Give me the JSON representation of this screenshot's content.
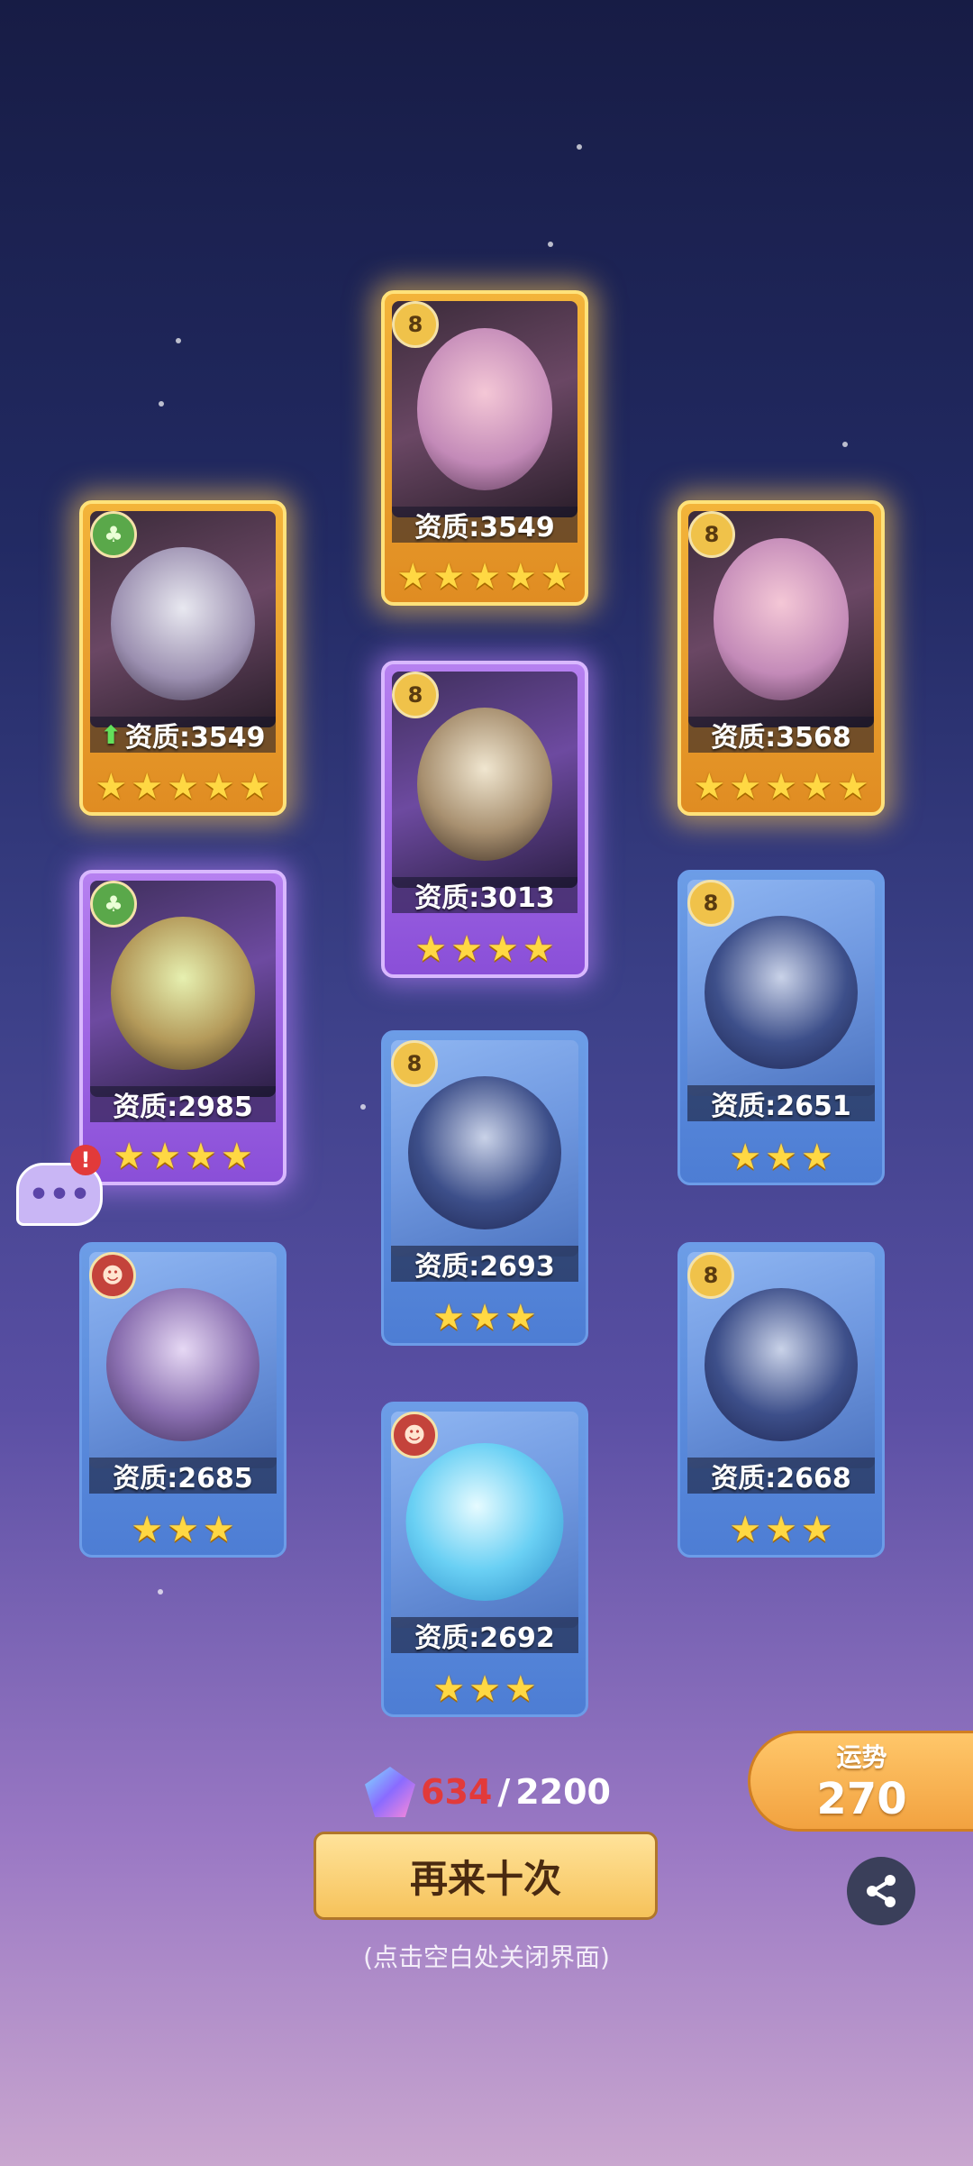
{
  "cards": [
    {
      "rarity": "gold",
      "faction": "yellow",
      "faction_glyph": "8",
      "stat_label": "资质:3549",
      "star_count": 5,
      "upgrade": false
    },
    {
      "rarity": "gold",
      "faction": "green",
      "faction_glyph": "♣",
      "stat_label": "资质:3549",
      "star_count": 5,
      "upgrade": true
    },
    {
      "rarity": "gold",
      "faction": "yellow",
      "faction_glyph": "8",
      "stat_label": "资质:3568",
      "star_count": 5,
      "upgrade": false
    },
    {
      "rarity": "purple",
      "faction": "yellow",
      "faction_glyph": "8",
      "stat_label": "资质:3013",
      "star_count": 4,
      "upgrade": false
    },
    {
      "rarity": "purple",
      "faction": "green",
      "faction_glyph": "♣",
      "stat_label": "资质:2985",
      "star_count": 4,
      "upgrade": false
    },
    {
      "rarity": "blue",
      "faction": "yellow",
      "faction_glyph": "8",
      "stat_label": "资质:2651",
      "star_count": 3,
      "upgrade": false
    },
    {
      "rarity": "blue",
      "faction": "yellow",
      "faction_glyph": "8",
      "stat_label": "资质:2693",
      "star_count": 3,
      "upgrade": false
    },
    {
      "rarity": "blue",
      "faction": "red",
      "faction_glyph": "☻",
      "stat_label": "资质:2685",
      "star_count": 3,
      "upgrade": false
    },
    {
      "rarity": "blue",
      "faction": "yellow",
      "faction_glyph": "8",
      "stat_label": "资质:2668",
      "star_count": 3,
      "upgrade": false
    },
    {
      "rarity": "blue",
      "faction": "red",
      "faction_glyph": "☻",
      "stat_label": "资质:2692",
      "star_count": 3,
      "upgrade": false
    }
  ],
  "currency": {
    "icon": "crystal-icon",
    "count": "634",
    "separator": "/",
    "max": "2200"
  },
  "again_button": {
    "label": "再来十次"
  },
  "close_hint": "(点击空白处关闭界面)",
  "fortune": {
    "label": "运势",
    "value": "270"
  },
  "chat": {
    "icon": "chat-icon",
    "alert": "!"
  },
  "share": {
    "icon": "share-icon"
  },
  "colors": {
    "gold": "#f3b43a",
    "purple": "#a36ce8",
    "blue": "#5d8ddc",
    "highlight_red": "#e23a3a"
  }
}
